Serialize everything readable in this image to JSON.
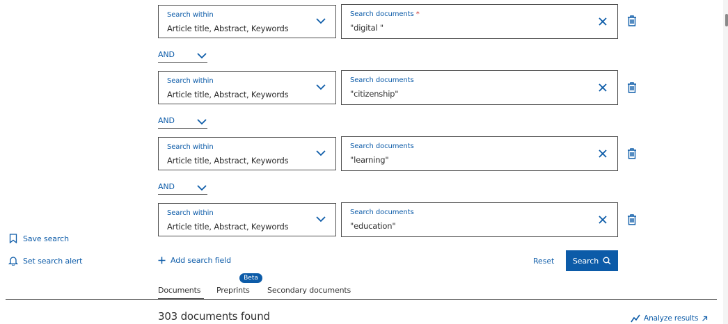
{
  "rows": [
    {
      "within_label": "Search within",
      "within_value": "Article title, Abstract, Keywords",
      "docs_label": "Search documents",
      "required_mark": "*",
      "docs_value": "\"digital \""
    },
    {
      "within_label": "Search within",
      "within_value": "Article title, Abstract, Keywords",
      "docs_label": "Search documents",
      "required_mark": "",
      "docs_value": "\"citizenship\""
    },
    {
      "within_label": "Search within",
      "within_value": "Article title, Abstract, Keywords",
      "docs_label": "Search documents",
      "required_mark": "",
      "docs_value": "\"learning\""
    },
    {
      "within_label": "Search within",
      "within_value": "Article title, Abstract, Keywords",
      "docs_label": "Search documents",
      "required_mark": "",
      "docs_value": "\"education\""
    }
  ],
  "operators": [
    "AND",
    "AND",
    "AND"
  ],
  "sidebar": {
    "save_search": "Save search",
    "set_alert": "Set search alert"
  },
  "actions": {
    "add_field": "Add search field",
    "reset": "Reset",
    "search": "Search"
  },
  "tabs": [
    {
      "label": "Documents",
      "active": true
    },
    {
      "label": "Preprints",
      "badge": "Beta"
    },
    {
      "label": "Secondary documents"
    }
  ],
  "results": {
    "found_text": "303 documents found",
    "analyze": "Analyze results"
  },
  "colors": {
    "accent": "#0c5ba8",
    "required": "#c9302c",
    "border": "#4d4d4d",
    "text": "#323232"
  },
  "icons": {
    "chevron": "chevron-down-icon",
    "clear": "close-icon",
    "delete": "trash-icon",
    "bookmark": "bookmark-icon",
    "bell": "bell-icon",
    "plus": "plus-icon",
    "search": "search-icon",
    "analyze": "line-chart-icon",
    "external": "arrow-up-right-icon"
  }
}
